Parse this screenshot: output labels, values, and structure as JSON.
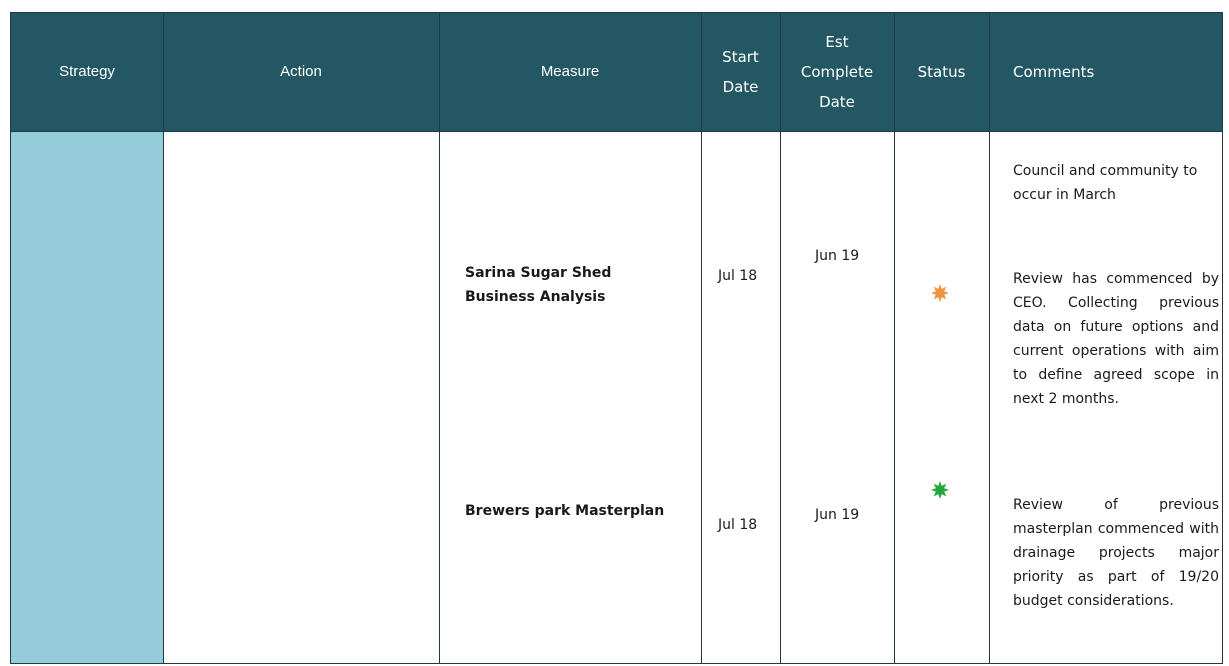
{
  "header": {
    "strategy": "Strategy",
    "action": "Action",
    "measure": "Measure",
    "start_date_line1": "Start",
    "start_date_line2": "Date",
    "est_line1": "Est",
    "est_line2": "Complete",
    "est_line3": "Date",
    "status": "Status",
    "comments": "Comments"
  },
  "rows": [
    {
      "comment": "Council and community to occur in March"
    },
    {
      "measure": "Sarina Sugar Shed Business Analysis",
      "start": "Jul 18",
      "est_complete": "Jun 19",
      "status_icon": "orange-star-icon",
      "status_color": "#f0953f",
      "comment": "Review has commenced by CEO. Collecting previous data on future options and current operations with aim to define agreed scope in next 2 months."
    },
    {
      "measure": "Brewers park Masterplan",
      "start": "Jul 18",
      "est_complete": "Jun 19",
      "status_icon": "green-star-icon",
      "status_color": "#22a83a",
      "comment": "Review of previous masterplan commenced with drainage projects major priority as part of 19/20 budget considerations."
    }
  ],
  "colors": {
    "header_bg": "#235763",
    "strategy_fill": "#94ccd9"
  }
}
